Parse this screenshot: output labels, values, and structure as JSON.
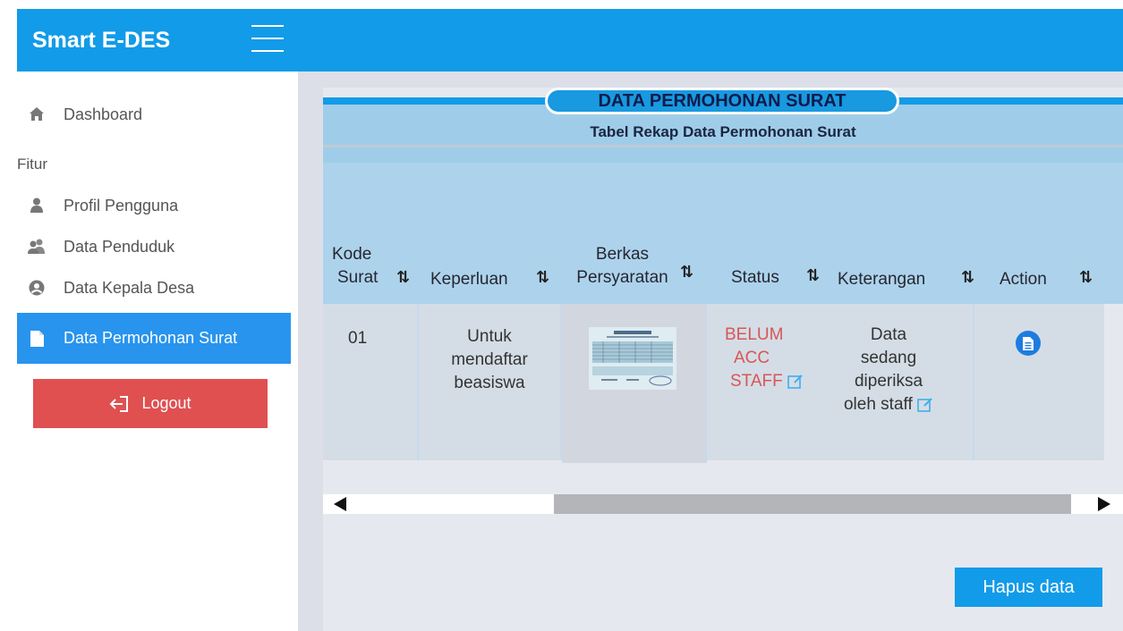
{
  "app": {
    "title": "Smart E-DES"
  },
  "sidebar": {
    "section_label": "Fitur",
    "items": [
      {
        "label": "Dashboard",
        "icon": "home-icon"
      },
      {
        "label": "Profil Pengguna",
        "icon": "user-icon"
      },
      {
        "label": "Data  Penduduk",
        "icon": "users-icon"
      },
      {
        "label": "Data Kepala Desa",
        "icon": "user-circle-icon"
      },
      {
        "label": "Data Permohonan Surat",
        "icon": "file-icon",
        "active": true
      }
    ],
    "logout_label": "Logout"
  },
  "panel": {
    "title": "DATA PERMOHONAN SURAT",
    "subtitle": "Tabel Rekap Data Permohonan Surat"
  },
  "table": {
    "headers": {
      "kode_line1": "Kode",
      "kode_line2": "Surat",
      "keperluan": "Keperluan",
      "berkas_line1": "Berkas",
      "berkas_line2": "Persyaratan",
      "status": "Status",
      "keterangan": "Keterangan",
      "action": "Action"
    },
    "sort_icon": "⇅",
    "rows": [
      {
        "kode": "01",
        "keperluan_lines": [
          "Untuk",
          "mendaftar",
          "beasiswa"
        ],
        "berkas": "kartu-keluarga-thumbnail",
        "status_lines": [
          "BELUM",
          "ACC",
          "STAFF"
        ],
        "keterangan_lines": [
          "Data",
          "sedang",
          "diperiksa",
          "oleh staff"
        ]
      }
    ]
  },
  "actions": {
    "delete_label": "Hapus data"
  },
  "colors": {
    "primary": "#129be8",
    "active_nav": "#2894ee",
    "logout": "#e05050",
    "status_pending": "#d85656"
  }
}
